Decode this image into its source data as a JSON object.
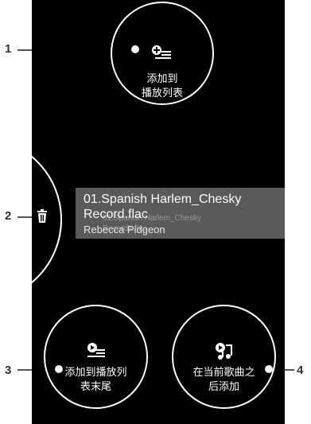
{
  "callouts": {
    "n1": "1",
    "n2": "2",
    "n3": "3",
    "n4": "4"
  },
  "buttons": {
    "add_to_playlist": "添加到\n播放列表",
    "add_to_end": "添加到播放列\n表末尾",
    "add_after_current": "在当前歌曲之\n后添加"
  },
  "track": {
    "title_line1": "01.Spanish Harlem_Chesky",
    "title_line2": "Record.flac",
    "ghost": "01.Spanish Harlem_Chesky\nRecords.flac",
    "artist": "Rebecca Pidgeon"
  },
  "icons": {
    "add_playlist": "playlist-add-icon",
    "delete": "trash-icon",
    "queue_end": "queue-end-icon",
    "play_next": "play-next-icon"
  },
  "colors": {
    "background": "#000000",
    "card": "#5a5a5a",
    "foreground": "#ffffff"
  }
}
